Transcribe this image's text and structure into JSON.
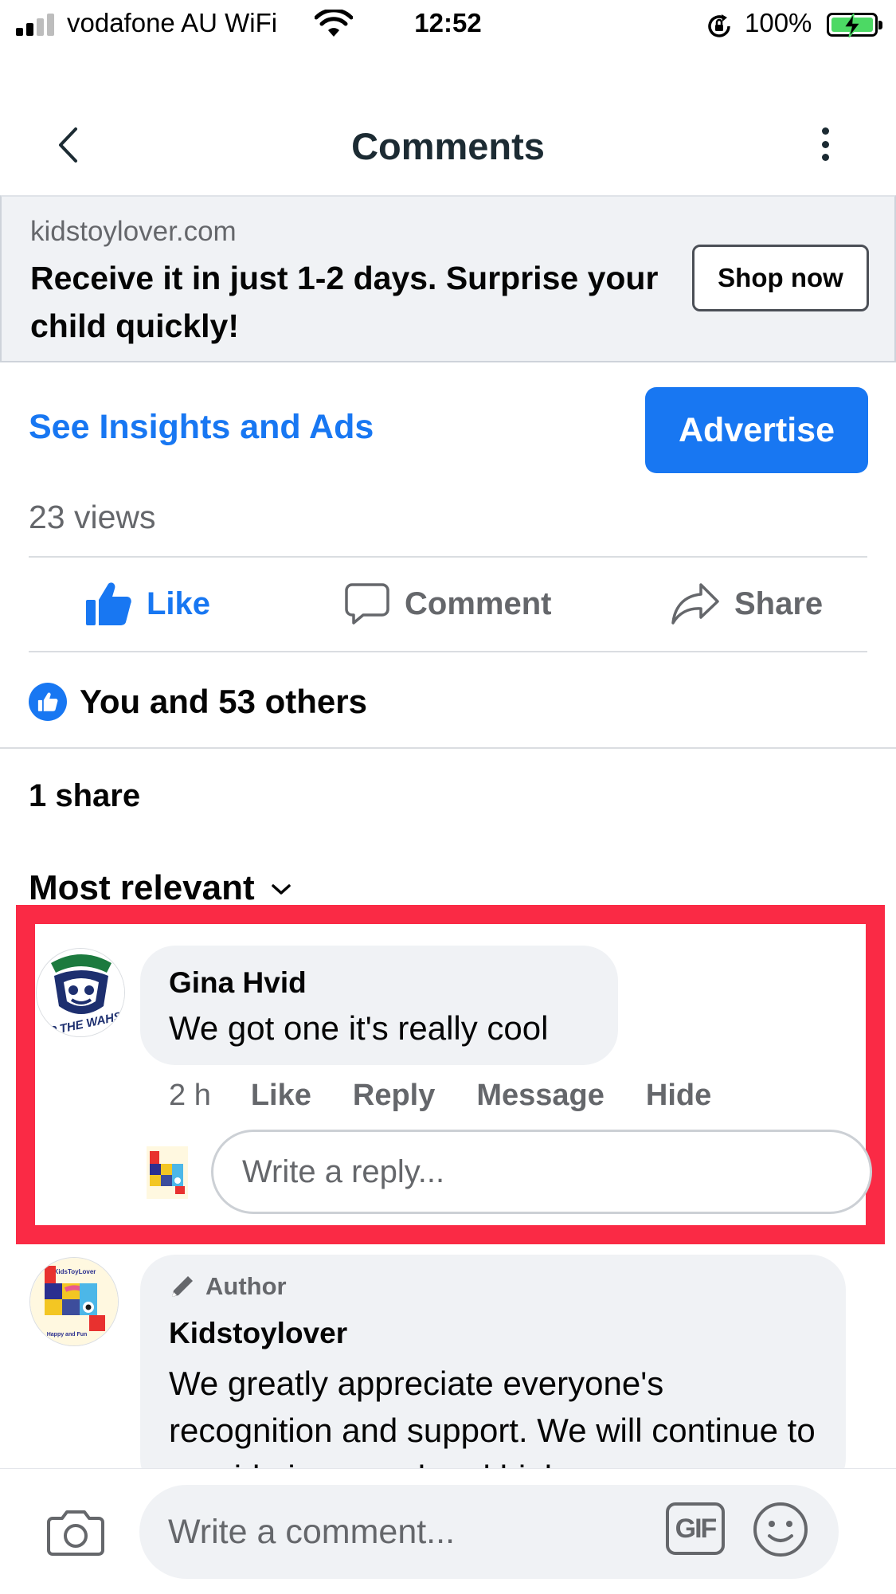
{
  "status_bar": {
    "carrier": "vodafone AU WiFi",
    "time": "12:52",
    "battery_percent": "100%",
    "icons": [
      "signal-icon",
      "wifi-icon",
      "rotation-lock-icon",
      "battery-charging-icon"
    ]
  },
  "header": {
    "title": "Comments",
    "icons": [
      "chevron-left-icon",
      "more-vertical-icon"
    ]
  },
  "ad": {
    "domain": "kidstoylover.com",
    "headline": "Receive it in just 1-2 days. Surprise your child quickly!",
    "cta_label": "Shop now"
  },
  "insights": {
    "link_label": "See Insights and Ads",
    "advertise_label": "Advertise"
  },
  "post_stats": {
    "views": "23 views",
    "reactions": "You and 53 others",
    "shares": "1 share"
  },
  "actions": {
    "like": "Like",
    "comment": "Comment",
    "share": "Share"
  },
  "sort": {
    "label": "Most relevant"
  },
  "comments": [
    {
      "author": "Gina Hvid",
      "text": "We got one it's really cool",
      "time": "2 h",
      "actions": [
        "Like",
        "Reply",
        "Message",
        "Hide"
      ],
      "reply_placeholder": "Write a reply..."
    },
    {
      "badge": "Author",
      "author": "Kidstoylover",
      "text": "We greatly appreciate everyone's recognition and support. We will continue to provide improved and high"
    }
  ],
  "avatar_texts": {
    "gina_logo": "UP THE WAHS",
    "kids_logo_top": "KidsToyLover",
    "kids_logo_bottom": "Happy and Fun"
  },
  "composer": {
    "placeholder": "Write a comment...",
    "gif_label": "GIF"
  },
  "colors": {
    "brand_blue": "#1877f2",
    "highlight_red": "#fa2a45",
    "bubble_gray": "#f0f2f5",
    "secondary_text": "#65676b"
  }
}
